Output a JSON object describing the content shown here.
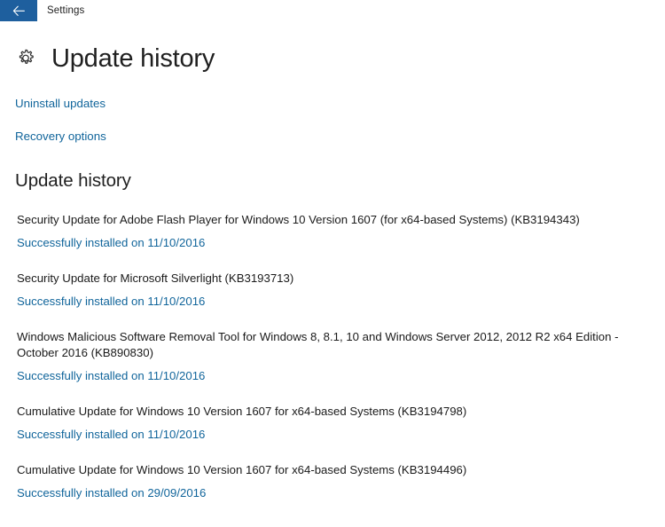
{
  "titlebar": {
    "back_icon": "back-arrow-icon",
    "app_name": "Settings",
    "back_button_color": "#1e5f9e"
  },
  "page": {
    "icon": "gear-icon",
    "title": "Update history",
    "link_color": "#11659b",
    "text_color": "#1a1a1a"
  },
  "actions": [
    {
      "label": "Uninstall updates",
      "name": "uninstall-updates-link"
    },
    {
      "label": "Recovery options",
      "name": "recovery-options-link"
    }
  ],
  "history": {
    "heading": "Update history",
    "items": [
      {
        "title": "Security Update for Adobe Flash Player for Windows 10 Version 1607 (for x64-based Systems) (KB3194343)",
        "status": "Successfully installed on 11/10/2016"
      },
      {
        "title": "Security Update for Microsoft Silverlight (KB3193713)",
        "status": "Successfully installed on 11/10/2016"
      },
      {
        "title": "Windows Malicious Software Removal Tool for Windows 8, 8.1, 10 and Windows Server 2012, 2012 R2 x64 Edition - October 2016 (KB890830)",
        "status": "Successfully installed on 11/10/2016"
      },
      {
        "title": "Cumulative Update for Windows 10 Version 1607 for x64-based Systems (KB3194798)",
        "status": "Successfully installed on 11/10/2016"
      },
      {
        "title": "Cumulative Update for Windows 10 Version 1607 for x64-based Systems (KB3194496)",
        "status": "Successfully installed on 29/09/2016"
      }
    ]
  }
}
